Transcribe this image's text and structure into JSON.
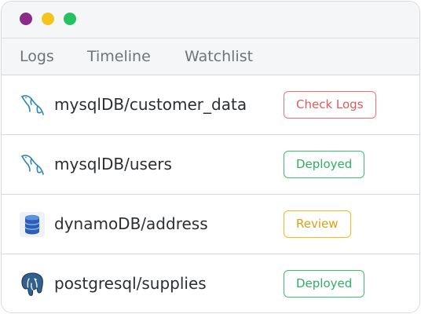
{
  "window": {
    "controls": [
      {
        "name": "close",
        "color": "#8a2c87"
      },
      {
        "name": "minimize",
        "color": "#f6c21c"
      },
      {
        "name": "maximize",
        "color": "#26c160"
      }
    ]
  },
  "tabs": [
    {
      "label": "Logs"
    },
    {
      "label": "Timeline"
    },
    {
      "label": "Watchlist"
    }
  ],
  "rows": [
    {
      "icon": "mysql-dolphin-icon",
      "name": "mysqlDB/customer_data",
      "status": "Check Logs",
      "status_type": "error"
    },
    {
      "icon": "mysql-dolphin-icon",
      "name": "mysqlDB/users",
      "status": "Deployed",
      "status_type": "success"
    },
    {
      "icon": "dynamodb-icon",
      "name": "dynamoDB/address",
      "status": "Review",
      "status_type": "warning"
    },
    {
      "icon": "postgresql-elephant-icon",
      "name": "postgresql/supplies",
      "status": "Deployed",
      "status_type": "success"
    }
  ],
  "colors": {
    "error": "#e05a5a",
    "success": "#2fae63",
    "warning": "#d9a10f",
    "mysql": "#2f86b4",
    "dynamodb": "#2d5fb5",
    "postgres": "#33618f"
  }
}
